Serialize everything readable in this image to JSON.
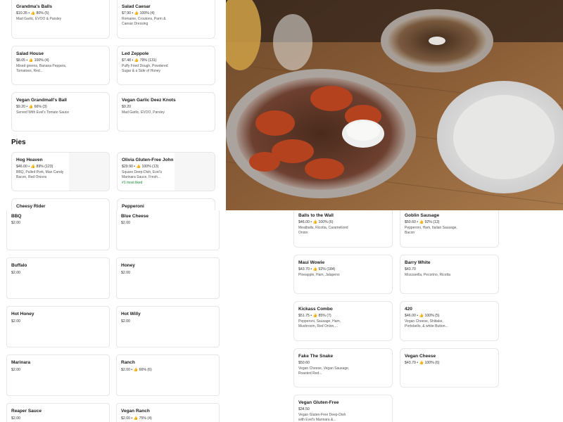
{
  "left_menu": {
    "top_items": [
      {
        "name": "Grandma's Balls",
        "meta": "$10.35 • 👍 80% (5)",
        "desc": "Mad Garlic, EVOO & Parsley"
      },
      {
        "name": "Salad Caesar",
        "meta": "$7.90 • 👍 100% (4)",
        "desc": "Romaine, Croutons, Parm & Caesar Dressing"
      },
      {
        "name": "Salad House",
        "meta": "$8.05 • 👍 100% (4)",
        "desc": "Mixed greens, Banana Peppers, Tomatoes, Red..."
      },
      {
        "name": "Led Zeppole",
        "meta": "$7.48 • 👍 79% (131)",
        "desc": "Puffy Fried Dough, Powdered Sugar & a Side of Honey"
      },
      {
        "name": "Vegan Grandmall's Ball",
        "meta": "$9.20 • 👍 66% (3)",
        "desc": "Served With Evel's Tomato Sauce"
      },
      {
        "name": "Vegan Garlic Deez Knots",
        "meta": "$9.20",
        "desc": "Mad Garlic, EVOO, Parsley"
      }
    ],
    "section_title": "Pies",
    "pies": [
      {
        "name": "Hog Heaven",
        "meta": "$46.00 • 👍 89% (123)",
        "desc": "BBQ, Pulled Pork, Man Candy Bacon, Red Onions"
      },
      {
        "name": "Olivia Gluten-Free John",
        "meta": "$29.90 • 👍 100% (13)",
        "desc": "Square Deep-Dish, Evel's Marinara Sauce, Fresh...",
        "badge": "#1 most liked"
      }
    ],
    "partial": [
      "Cheesy Rider",
      "Pepperoni"
    ]
  },
  "sauce_options": [
    {
      "name": "BBQ",
      "price": "$2.00"
    },
    {
      "name": "Blue Cheese",
      "price": "$2.00"
    },
    {
      "name": "Buffalo",
      "price": "$2.00"
    },
    {
      "name": "Honey",
      "price": "$2.00"
    },
    {
      "name": "Hot Honey",
      "price": "$2.00"
    },
    {
      "name": "Hot Willy",
      "price": "$2.00"
    },
    {
      "name": "Marinara",
      "price": "$2.00"
    },
    {
      "name": "Ranch",
      "price": "$2.00 • 👍 66% (6)"
    },
    {
      "name": "Reaper Sauce",
      "price": "$2.00"
    },
    {
      "name": "Vegan Ranch",
      "price": "$2.00 • 👍 75% (4)"
    }
  ],
  "right_menu": [
    {
      "name": "Balls to the Wall",
      "meta": "$46.00 • 👍 100% (6)",
      "desc": "Meatballs, Ricotta, Caramelized Onion"
    },
    {
      "name": "Goblin Sausage",
      "meta": "$50.60 • 👍 92% (13)",
      "desc": "Pepperoni, Ham, Italian Sausage, Bacon"
    },
    {
      "name": "Maui Wowie",
      "meta": "$43.70 • 👍 92% (184)",
      "desc": "Pineapple, Ham, Jalapeno"
    },
    {
      "name": "Barry White",
      "meta": "$43.70",
      "desc": "Mozzarella, Pecorino, Ricotta"
    },
    {
      "name": "Kickass Combo",
      "meta": "$51.75 • 👍 85% (7)",
      "desc": "Pepperoni, Sausage, Ham, Mushroom, Red Onion,..."
    },
    {
      "name": "420",
      "meta": "$46.00 • 👍 100% (5)",
      "desc": "Vegan Cheese, Shiitake, Portobello, & white Button..."
    },
    {
      "name": "Fake The Snake",
      "meta": "$50.60",
      "desc": "Vegan Cheese, Vegan Sausage, Roasted Red..."
    },
    {
      "name": "Vegan Cheese",
      "meta": "$43.70 • 👍 100% (6)",
      "desc": ""
    },
    {
      "name": "Vegan Gluten-Free",
      "meta": "$34.50",
      "desc": "Vegan Gluten-Free Deep-Dish with Evel's Marinara &..."
    }
  ]
}
